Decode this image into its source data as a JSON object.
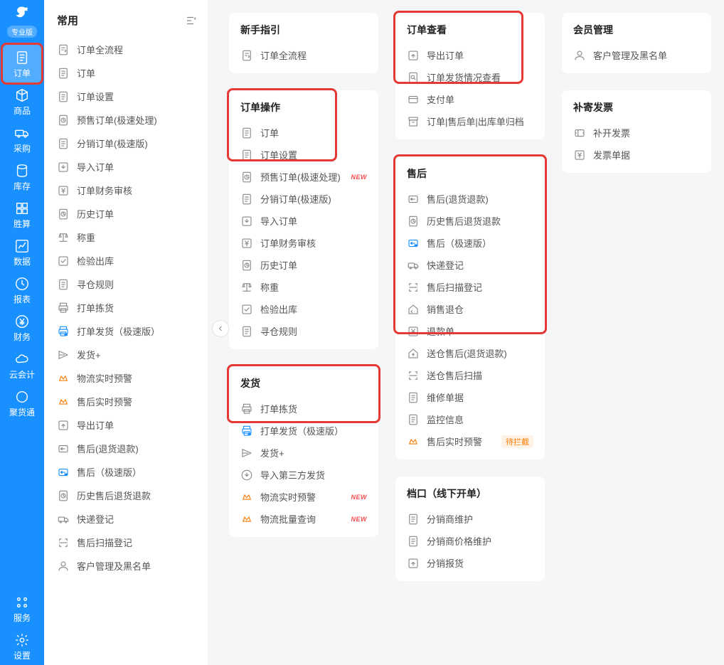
{
  "sidebar": {
    "edition": "专业版",
    "items": [
      {
        "label": "订单",
        "icon": "doc"
      },
      {
        "label": "商品",
        "icon": "cube"
      },
      {
        "label": "采购",
        "icon": "truck"
      },
      {
        "label": "库存",
        "icon": "db"
      },
      {
        "label": "胜算",
        "icon": "grid"
      },
      {
        "label": "数据",
        "icon": "chart"
      },
      {
        "label": "报表",
        "icon": "clock"
      },
      {
        "label": "财务",
        "icon": "yen"
      },
      {
        "label": "云会计",
        "icon": "cloud"
      },
      {
        "label": "聚货通",
        "icon": "circle"
      }
    ],
    "bottom": [
      {
        "label": "服务",
        "icon": "apps"
      },
      {
        "label": "设置",
        "icon": "gear"
      }
    ]
  },
  "common": {
    "title": "常用",
    "items": [
      {
        "label": "订单全流程",
        "icon": "flow"
      },
      {
        "label": "订单",
        "icon": "doc"
      },
      {
        "label": "订单设置",
        "icon": "doc"
      },
      {
        "label": "预售订单(极速处理)",
        "icon": "clock-doc"
      },
      {
        "label": "分销订单(极速版)",
        "icon": "doc"
      },
      {
        "label": "导入订单",
        "icon": "import"
      },
      {
        "label": "订单财务审核",
        "icon": "yen-box"
      },
      {
        "label": "历史订单",
        "icon": "history"
      },
      {
        "label": "称重",
        "icon": "scale"
      },
      {
        "label": "检验出库",
        "icon": "check-box"
      },
      {
        "label": "寻仓规则",
        "icon": "doc"
      },
      {
        "label": "打单拣货",
        "icon": "print"
      },
      {
        "label": "打单发货（极速版）",
        "icon": "print-fast",
        "accent": true
      },
      {
        "label": "发货+",
        "icon": "send"
      },
      {
        "label": "物流实时预警",
        "icon": "vip-alert",
        "vip": true
      },
      {
        "label": "售后实时预警",
        "icon": "vip-alert",
        "vip": true
      },
      {
        "label": "导出订单",
        "icon": "export"
      },
      {
        "label": "售后(退货退款)",
        "icon": "return"
      },
      {
        "label": "售后（极速版）",
        "icon": "return-fast",
        "accent": true
      },
      {
        "label": "历史售后退货退款",
        "icon": "history"
      },
      {
        "label": "快递登记",
        "icon": "truck-box"
      },
      {
        "label": "售后扫描登记",
        "icon": "scan"
      },
      {
        "label": "客户管理及黑名单",
        "icon": "user"
      }
    ]
  },
  "col1": [
    {
      "title": "新手指引",
      "items": [
        {
          "label": "订单全流程",
          "icon": "flow"
        }
      ]
    },
    {
      "title": "订单操作",
      "hl": "hl-a",
      "items": [
        {
          "label": "订单",
          "icon": "doc"
        },
        {
          "label": "订单设置",
          "icon": "doc"
        },
        {
          "label": "预售订单(极速处理)",
          "icon": "clock-doc",
          "new": true
        },
        {
          "label": "分销订单(极速版)",
          "icon": "doc"
        },
        {
          "label": "导入订单",
          "icon": "import"
        },
        {
          "label": "订单财务审核",
          "icon": "yen-box"
        },
        {
          "label": "历史订单",
          "icon": "history"
        },
        {
          "label": "称重",
          "icon": "scale"
        },
        {
          "label": "检验出库",
          "icon": "check-box"
        },
        {
          "label": "寻仓规则",
          "icon": "doc"
        }
      ]
    },
    {
      "title": "发货",
      "hl": "hl-b",
      "items": [
        {
          "label": "打单拣货",
          "icon": "print"
        },
        {
          "label": "打单发货（极速版）",
          "icon": "print-fast",
          "accent": true
        },
        {
          "label": "发货+",
          "icon": "send"
        },
        {
          "label": "导入第三方发货",
          "icon": "import3"
        },
        {
          "label": "物流实时预警",
          "icon": "vip-alert",
          "vip": true,
          "new": true
        },
        {
          "label": "物流批量查询",
          "icon": "vip-alert",
          "vip": true,
          "new": true
        }
      ]
    }
  ],
  "col2": [
    {
      "title": "订单查看",
      "hl": "hl-c",
      "items": [
        {
          "label": "导出订单",
          "icon": "export"
        },
        {
          "label": "订单发货情况查看",
          "icon": "search-doc"
        },
        {
          "label": "支付单",
          "icon": "pay"
        },
        {
          "label": "订单|售后单|出库单归档",
          "icon": "archive"
        }
      ]
    },
    {
      "title": "售后",
      "hl": "hl-d",
      "items": [
        {
          "label": "售后(退货退款)",
          "icon": "return"
        },
        {
          "label": "历史售后退货退款",
          "icon": "history"
        },
        {
          "label": "售后（极速版）",
          "icon": "return-fast",
          "accent": true
        },
        {
          "label": "快递登记",
          "icon": "truck-box"
        },
        {
          "label": "售后扫描登记",
          "icon": "scan"
        },
        {
          "label": "销售退仓",
          "icon": "home-ret"
        },
        {
          "label": "退款单",
          "icon": "yen-box"
        },
        {
          "label": "送仓售后(退货退款)",
          "icon": "home-up"
        },
        {
          "label": "送仓售后扫描",
          "icon": "scan"
        },
        {
          "label": "维修单据",
          "icon": "doc"
        },
        {
          "label": "监控信息",
          "icon": "doc"
        },
        {
          "label": "售后实时预警",
          "icon": "vip-alert",
          "vip": true,
          "badge": "待拦截"
        }
      ]
    },
    {
      "title": "档口（线下开单）",
      "items": [
        {
          "label": "分销商维护",
          "icon": "doc"
        },
        {
          "label": "分销商价格维护",
          "icon": "doc"
        },
        {
          "label": "分销报货",
          "icon": "out"
        }
      ]
    }
  ],
  "col3": [
    {
      "title": "会员管理",
      "items": [
        {
          "label": "客户管理及黑名单",
          "icon": "user"
        }
      ]
    },
    {
      "title": "补寄发票",
      "items": [
        {
          "label": "补开发票",
          "icon": "ticket"
        },
        {
          "label": "发票单据",
          "icon": "yen-box"
        }
      ]
    }
  ],
  "badges": {
    "new": "NEW"
  }
}
